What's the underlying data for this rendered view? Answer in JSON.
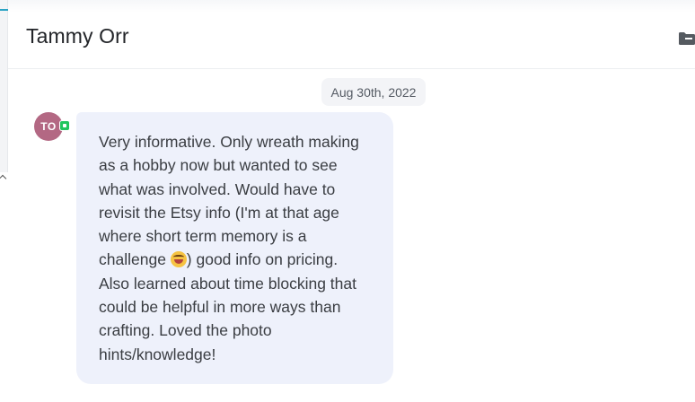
{
  "header": {
    "contact_name": "Tammy Orr",
    "folder_icon": "folder-icon"
  },
  "conversation": {
    "date_label": "Aug 30th, 2022",
    "message": {
      "sender_initials": "TO",
      "avatar_color": "#b36883",
      "channel_badge_color": "#22c55e",
      "text_before_emoji": "Very informative. Only wreath making as a hobby now but wanted to see what was involved. Would have to revisit the Etsy info (I'm at that age where short term memory is a challenge ",
      "emoji": "laughing-face-emoji",
      "text_after_emoji": ") good info on pricing. Also learned about time blocking that could be helpful in more ways than crafting. Loved the photo hints/knowledge!"
    }
  }
}
